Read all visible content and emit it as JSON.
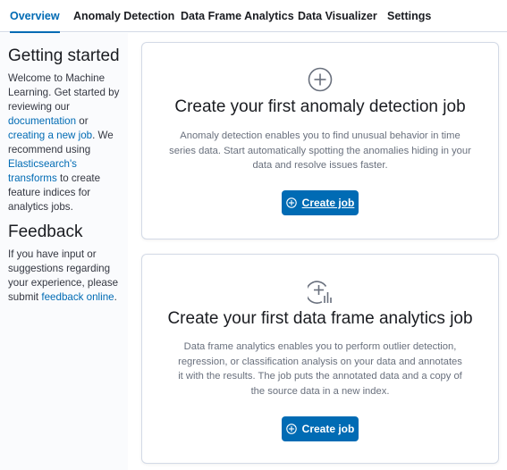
{
  "tabs": [
    {
      "label": "Overview",
      "active": true
    },
    {
      "label": "Anomaly Detection",
      "active": false
    },
    {
      "label": "Data Frame Analytics",
      "active": false
    },
    {
      "label": "Data Visualizer",
      "active": false
    },
    {
      "label": "Settings",
      "active": false
    }
  ],
  "sidebar": {
    "getting_started": {
      "title": "Getting started",
      "text_1": "Welcome to Machine Learning. Get started by reviewing our ",
      "link_documentation": "documentation",
      "text_2": " or ",
      "link_new_job": "creating a new job",
      "text_3": ". We recommend using ",
      "link_transforms": "Elasticsearch's transforms",
      "text_4": " to create feature indices for analytics jobs."
    },
    "feedback": {
      "title": "Feedback",
      "text_1": "If you have input or suggestions regarding your experience, please submit ",
      "link_feedback": "feedback online",
      "text_2": "."
    }
  },
  "cards": {
    "anomaly": {
      "title": "Create your first anomaly detection job",
      "description": "Anomaly detection enables you to find unusual behavior in time series data. Start automatically spotting the anomalies hiding in your data and resolve issues faster.",
      "button_label": "Create job",
      "icon": "plus-in-circle-icon"
    },
    "dfa": {
      "title": "Create your first data frame analytics job",
      "description": "Data frame analytics enables you to perform outlier detection, regression, or classification analysis on your data and annotates it with the results. The job puts the annotated data and a copy of the source data in a new index.",
      "button_label": "Create job",
      "icon": "analytics-plus-icon"
    }
  },
  "colors": {
    "accent": "#006bb4",
    "text": "#343741",
    "muted": "#69707d",
    "border": "#d3dae6"
  }
}
